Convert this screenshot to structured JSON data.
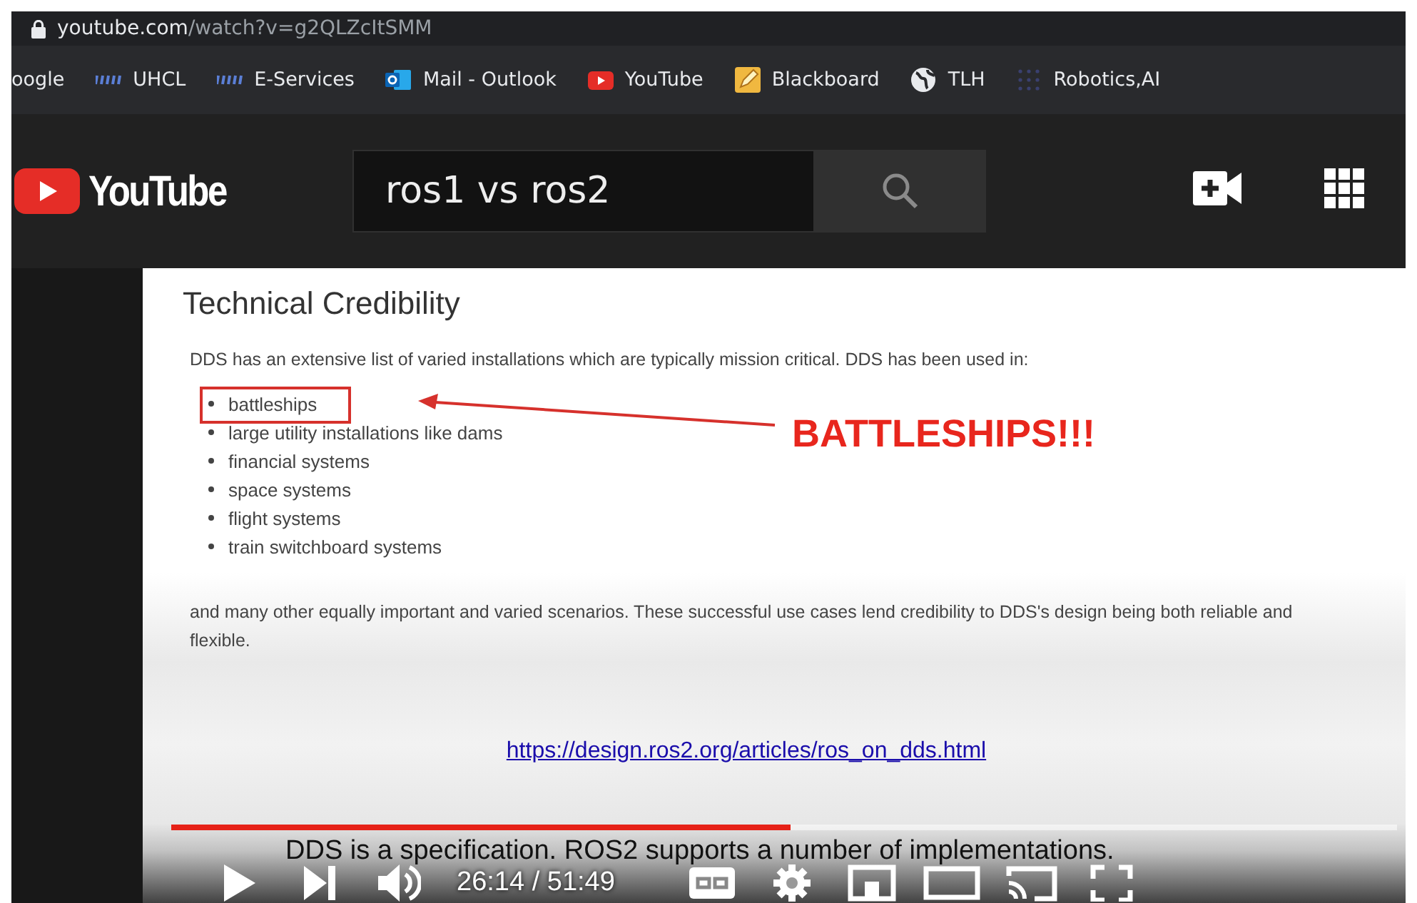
{
  "browser": {
    "url_host": "youtube.com",
    "url_path": "/watch?v=g2QLZcItSMM",
    "bookmarks": [
      {
        "label": "oogle",
        "kind": "plain"
      },
      {
        "label": "UHCL",
        "kind": "uhcl"
      },
      {
        "label": "E-Services",
        "kind": "uhcl"
      },
      {
        "label": "Mail - Outlook",
        "kind": "mail"
      },
      {
        "label": "YouTube",
        "kind": "play"
      },
      {
        "label": "Blackboard",
        "kind": "pencil"
      },
      {
        "label": "TLH",
        "kind": "globe"
      },
      {
        "label": "Robotics,AI",
        "kind": "dots"
      }
    ]
  },
  "header": {
    "logo": "YouTube",
    "search": {
      "value": "ros1 vs ros2"
    }
  },
  "slide": {
    "title": "Technical Credibility",
    "intro": "DDS has an extensive list of varied installations which are typically mission critical. DDS has been used in:",
    "items": [
      {
        "text": "battleships",
        "highlighted": true
      },
      {
        "text": "large utility installations like dams",
        "highlighted": false
      },
      {
        "text": "financial systems",
        "highlighted": false
      },
      {
        "text": "space systems",
        "highlighted": false
      },
      {
        "text": "flight systems",
        "highlighted": false
      },
      {
        "text": "train switchboard systems",
        "highlighted": false
      }
    ],
    "callout": "BATTLESHIPS!!!",
    "paragraph": "and many other equally important and varied scenarios. These successful use cases lend credibility to DDS's design being both reliable and flexible.",
    "link": "https://design.ros2.org/articles/ros_on_dds.html"
  },
  "player": {
    "caption": "DDS is a specification. ROS2 supports a number of implementations.",
    "level": 0.505,
    "time": "26:14 / 51:49"
  }
}
